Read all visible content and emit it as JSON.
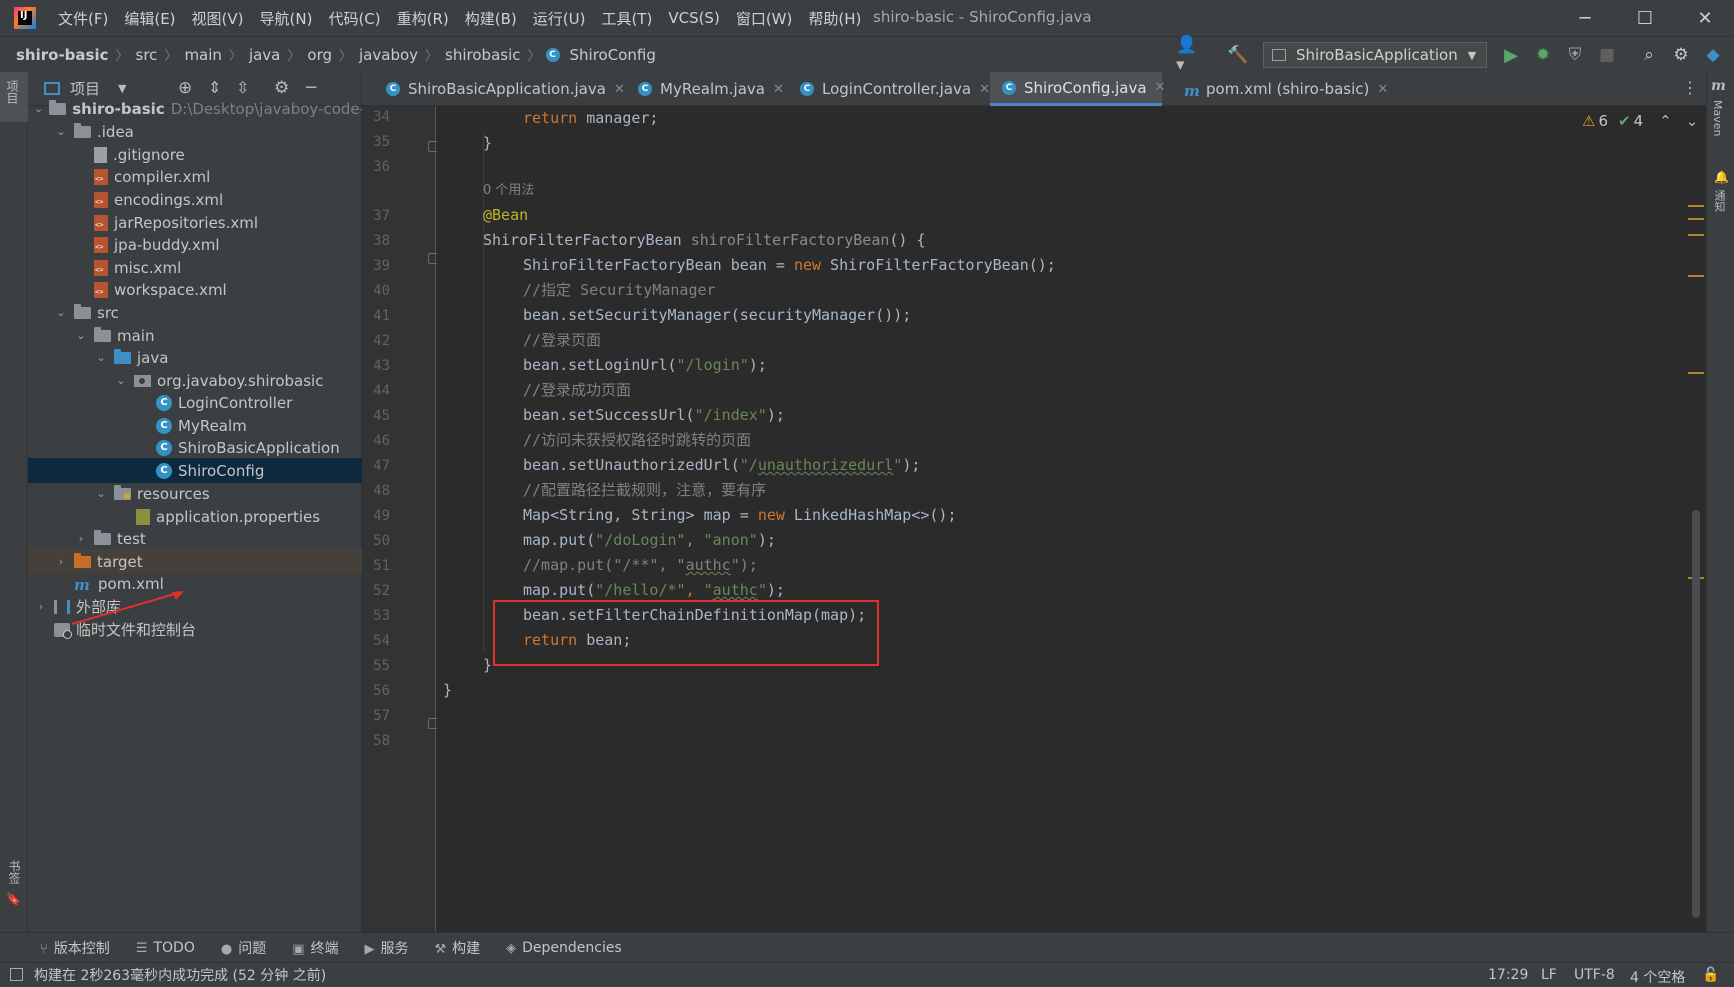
{
  "window": {
    "title": "shiro-basic - ShiroConfig.java",
    "menu": [
      "文件(F)",
      "编辑(E)",
      "视图(V)",
      "导航(N)",
      "代码(C)",
      "重构(R)",
      "构建(B)",
      "运行(U)",
      "工具(T)",
      "VCS(S)",
      "窗口(W)",
      "帮助(H)"
    ],
    "minimize": "─",
    "maximize": "☐",
    "close": "✕"
  },
  "breadcrumb": [
    "shiro-basic",
    "src",
    "main",
    "java",
    "org",
    "javaboy",
    "shirobasic",
    "ShiroConfig"
  ],
  "run_config": "ShiroBasicApplication",
  "left_stripe": {
    "project": "项目",
    "bookmarks": "书签",
    "structure": "结构"
  },
  "right_stripe": {
    "maven": "Maven",
    "notifications": "通知"
  },
  "project_panel": {
    "title": "项目",
    "tree": [
      {
        "label": "shiro-basic",
        "extra": "D:\\Desktop\\javaboy-code-",
        "icon": "folder-icon"
      },
      {
        "label": ".idea",
        "icon": "folder-icon"
      },
      {
        "label": ".gitignore",
        "icon": "file-icon"
      },
      {
        "label": "compiler.xml",
        "icon": "xml-icon"
      },
      {
        "label": "encodings.xml",
        "icon": "xml-icon"
      },
      {
        "label": "jarRepositories.xml",
        "icon": "xml-icon"
      },
      {
        "label": "jpa-buddy.xml",
        "icon": "xml-icon"
      },
      {
        "label": "misc.xml",
        "icon": "xml-icon"
      },
      {
        "label": "workspace.xml",
        "icon": "xml-icon"
      },
      {
        "label": "src",
        "icon": "folder-icon"
      },
      {
        "label": "main",
        "icon": "folder-icon"
      },
      {
        "label": "java",
        "icon": "folder-icon"
      },
      {
        "label": "org.javaboy.shirobasic",
        "icon": "package-icon"
      },
      {
        "label": "LoginController",
        "icon": "class-icon"
      },
      {
        "label": "MyRealm",
        "icon": "class-icon"
      },
      {
        "label": "ShiroBasicApplication",
        "icon": "class-icon"
      },
      {
        "label": "ShiroConfig",
        "icon": "class-icon"
      },
      {
        "label": "resources",
        "icon": "folder-icon"
      },
      {
        "label": "application.properties",
        "icon": "properties-icon"
      },
      {
        "label": "test",
        "icon": "folder-icon"
      },
      {
        "label": "target",
        "icon": "folder-icon"
      },
      {
        "label": "pom.xml",
        "icon": "maven-icon"
      },
      {
        "label": "外部库",
        "icon": "library-icon"
      },
      {
        "label": "临时文件和控制台",
        "icon": "scratch-icon"
      }
    ]
  },
  "tabs": [
    {
      "label": "ShiroBasicApplication.java"
    },
    {
      "label": "MyRealm.java"
    },
    {
      "label": "LoginController.java"
    },
    {
      "label": "ShiroConfig.java"
    },
    {
      "label": "pom.xml (shiro-basic)"
    }
  ],
  "inspections": {
    "warnings": "6",
    "checks": "4"
  },
  "editor": {
    "line_numbers": [
      "34",
      "35",
      "36",
      "37",
      "38",
      "39",
      "40",
      "41",
      "42",
      "43",
      "44",
      "45",
      "46",
      "47",
      "48",
      "49",
      "50",
      "51",
      "52",
      "53",
      "54",
      "55",
      "56",
      "57",
      "58"
    ],
    "usage_hint": "0 个用法",
    "lines": {
      "l34_kw": "return",
      "l34_rest": " manager;",
      "l35": "}",
      "l37": "@Bean",
      "l38_type": "ShiroFilterFactoryBean ",
      "l38_name": "shiroFilterFactoryBean",
      "l38_rest": "() {",
      "l39_a": "ShiroFilterFactoryBean bean = ",
      "l39_kw": "new",
      "l39_b": " ShiroFilterFactoryBean();",
      "l40": "//指定 SecurityManager",
      "l41": "bean.setSecurityManager(securityManager());",
      "l42": "//登录页面",
      "l43_a": "bean.setLoginUrl(",
      "l43_s": "\"/login\"",
      "l43_b": ");",
      "l44": "//登录成功页面",
      "l45_a": "bean.setSuccessUrl(",
      "l45_s": "\"/index\"",
      "l45_b": ");",
      "l46": "//访问未获授权路径时跳转的页面",
      "l47_a": "bean.setUnauthorizedUrl(",
      "l47_s1": "\"/",
      "l47_s2": "unauthorizedurl",
      "l47_s3": "\"",
      "l47_b": ");",
      "l48": "//配置路径拦截规则，注意，要有序",
      "l49_a": "Map<String, String> map = ",
      "l49_kw": "new",
      "l49_b": " LinkedHashMap<>();",
      "l50_a": "map.put(",
      "l50_s1": "\"/doLogin\"",
      "l50_c": ", ",
      "l50_s2": "\"anon\"",
      "l50_b": ");",
      "l51_a": "//map.put(\"/**\", \"",
      "l51_w": "authc",
      "l51_b": "\");",
      "l52_a": "map.put(",
      "l52_s1": "\"/hello/*\"",
      "l52_c": ", ",
      "l52_s2q": "\"",
      "l52_s2w": "authc",
      "l52_s2e": "\"",
      "l52_b": ");",
      "l53": "bean.setFilterChainDefinitionMap(map);",
      "l54_kw": "return",
      "l54_rest": " bean;",
      "l55": "}",
      "l56": "}"
    }
  },
  "bottom_tools": [
    "版本控制",
    "TODO",
    "问题",
    "终端",
    "服务",
    "构建",
    "Dependencies"
  ],
  "status": {
    "message": "构建在 2秒263毫秒内成功完成 (52 分钟 之前)",
    "position": "17:29",
    "line_sep": "LF",
    "encoding": "UTF-8",
    "indent": "4 个空格"
  },
  "colors": {
    "accent": "#4a88c7",
    "keyword": "#cc7832",
    "string": "#6a8759",
    "comment": "#808080",
    "annotation": "#bbb529",
    "highlight_box": "#e03030"
  }
}
